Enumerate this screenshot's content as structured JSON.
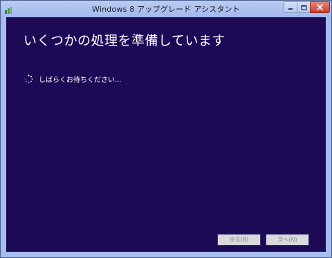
{
  "window": {
    "title": "Windows 8 アップグレード アシスタント"
  },
  "caption_buttons": {
    "minimize_icon": "minimize-icon",
    "maximize_icon": "maximize-icon",
    "close_icon": "close-icon"
  },
  "main": {
    "heading": "いくつかの処理を準備しています",
    "status": "しばらくお待ちください..."
  },
  "footer": {
    "back_label": "戻る(B)",
    "next_label": "次へ(N)"
  },
  "colors": {
    "client_background": "#1d0a57",
    "titlebar": "#a7bdf0",
    "close_button": "#c7402f"
  }
}
